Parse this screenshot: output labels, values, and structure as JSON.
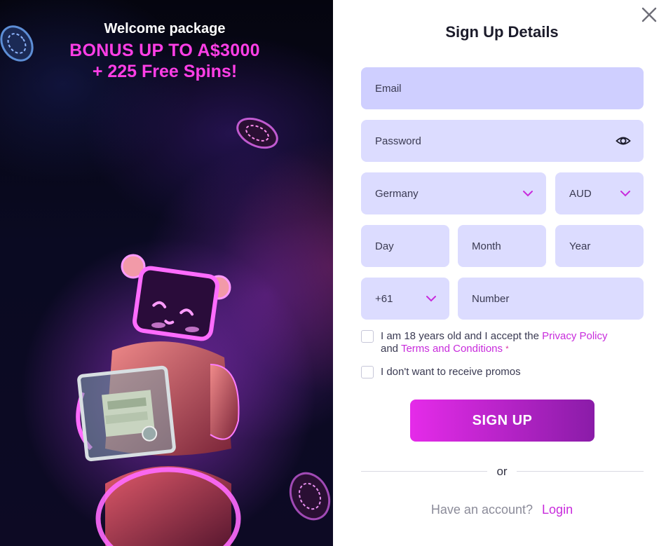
{
  "promo": {
    "line1": "Welcome package",
    "line2": "BONUS UP TO A$3000",
    "line3": "+ 225 Free Spins!"
  },
  "form": {
    "title": "Sign Up Details",
    "email_placeholder": "Email",
    "password_placeholder": "Password",
    "country": "Germany",
    "currency": "AUD",
    "day_placeholder": "Day",
    "month_placeholder": "Month",
    "year_placeholder": "Year",
    "phone_code": "+61",
    "number_placeholder": "Number",
    "terms_prefix": "I am 18 years old and I accept the",
    "privacy_link": "Privacy Policy",
    "terms_and": "and",
    "terms_link": "Terms and Conditions",
    "required_mark": "*",
    "promos_label": "I don't want to receive promos",
    "signup_label": "SIGN UP",
    "or_label": "or",
    "have_account": "Have an account?",
    "login_label": "Login"
  },
  "colors": {
    "accent": "#c82bdc",
    "promo_pink": "#ff3ee6",
    "field_bg": "#dcdcff",
    "button_start": "#e52be9",
    "button_end": "#8a1ca8"
  },
  "icons": [
    "close-icon",
    "eye-icon",
    "chevron-down-icon",
    "poker-chip-icon",
    "robot-mascot-illustration"
  ]
}
